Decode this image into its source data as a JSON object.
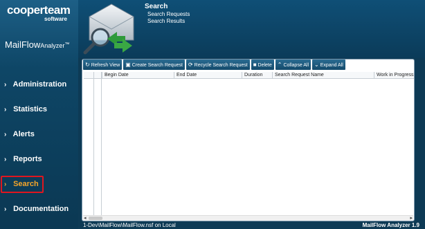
{
  "brand": {
    "logo": "cooperteam",
    "logo_sub": "software",
    "product": "MailFlow",
    "product_sub": "Analyzer",
    "product_tm": "™"
  },
  "header": {
    "title": "Search",
    "links": [
      "Search Requests",
      "Search Results"
    ]
  },
  "sidebar": {
    "items": [
      {
        "label": "Administration",
        "active": false
      },
      {
        "label": "Statistics",
        "active": false
      },
      {
        "label": "Alerts",
        "active": false
      },
      {
        "label": "Reports",
        "active": false
      },
      {
        "label": "Search",
        "active": true
      },
      {
        "label": "Documentation",
        "active": false
      }
    ]
  },
  "toolbar": {
    "refresh": "Refresh View",
    "create": "Create Search Request",
    "recycle": "Recycle Search Request",
    "delete": "Delete",
    "collapse": "Collapse All",
    "expand": "Expand All"
  },
  "grid": {
    "columns": [
      "Begin Date",
      "End Date",
      "Duration",
      "Search Request Name",
      "Work in Progress"
    ]
  },
  "status": {
    "path": "1-Dev\\MailFlow\\MailFlow.nsf on Local",
    "version": "MailFlow Analyzer 1.9"
  },
  "colors": {
    "sidebar": "#0e4666",
    "active_nav": "#f4a52a",
    "highlight_border": "#e0161f"
  }
}
